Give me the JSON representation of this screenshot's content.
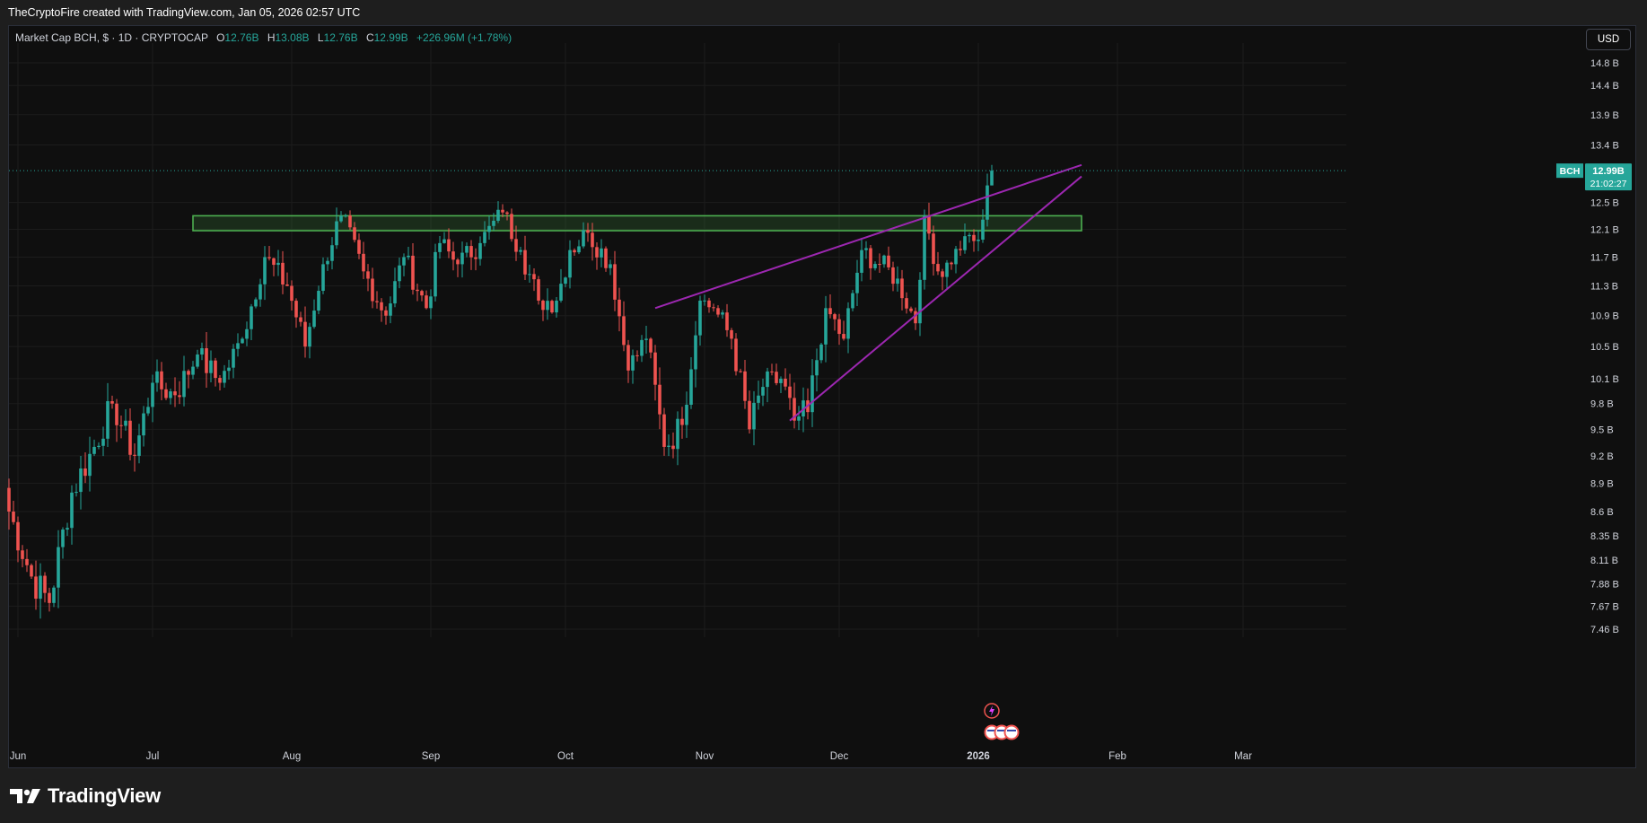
{
  "header": {
    "credit": "TheCryptoFire created with TradingView.com, Jan 05, 2026 02:57 UTC"
  },
  "legend": {
    "symbol": "Market Cap BCH, $ · 1D · CRYPTOCAP",
    "o_label": "O",
    "o_value": "12.76B",
    "h_label": "H",
    "h_value": "13.08B",
    "l_label": "L",
    "l_value": "12.76B",
    "c_label": "C",
    "c_value": "12.99B",
    "change": "+226.96M (+1.78%)"
  },
  "currency_button": "USD",
  "price_tag": {
    "symbol": "BCH",
    "price": "12.99B",
    "countdown": "21:02:27"
  },
  "footer": {
    "logo_text": "TradingView"
  },
  "colors": {
    "up": "#26a69a",
    "down": "#ef5350",
    "zone": "#4caf50",
    "trendline": "#9c27b0",
    "grid": "#1c1c1c"
  },
  "chart_data": {
    "type": "candlestick",
    "y_axis": {
      "scale": "log",
      "unit": "USD billions",
      "ticks": [
        7.46,
        7.67,
        7.88,
        8.11,
        8.35,
        8.6,
        8.9,
        9.2,
        9.5,
        9.8,
        10.1,
        10.5,
        10.9,
        11.3,
        11.7,
        12.1,
        12.5,
        13.4,
        13.9,
        14.4,
        14.8
      ],
      "tick_labels": [
        "7.46 B",
        "7.67 B",
        "7.88 B",
        "8.11 B",
        "8.35 B",
        "8.6 B",
        "8.9 B",
        "9.2 B",
        "9.5 B",
        "9.8 B",
        "10.1 B",
        "10.5 B",
        "10.9 B",
        "11.3 B",
        "11.7 B",
        "12.1 B",
        "12.5 B",
        "13.4 B",
        "13.9 B",
        "14.4 B",
        "14.8 B"
      ]
    },
    "x_axis": {
      "start": "2025-05-30",
      "ticks": [
        {
          "date": "2025-06-01",
          "label": "Jun"
        },
        {
          "date": "2025-07-01",
          "label": "Jul"
        },
        {
          "date": "2025-08-01",
          "label": "Aug"
        },
        {
          "date": "2025-09-01",
          "label": "Sep"
        },
        {
          "date": "2025-10-01",
          "label": "Oct"
        },
        {
          "date": "2025-11-01",
          "label": "Nov"
        },
        {
          "date": "2025-12-01",
          "label": "Dec"
        },
        {
          "date": "2026-01-01",
          "label": "2026"
        },
        {
          "date": "2026-02-01",
          "label": "Feb"
        },
        {
          "date": "2026-03-01",
          "label": "Mar"
        }
      ]
    },
    "anchors": [
      {
        "date": "2025-05-30",
        "close": 8.6
      },
      {
        "date": "2025-06-04",
        "close": 7.95
      },
      {
        "date": "2025-06-08",
        "close": 7.7
      },
      {
        "date": "2025-06-13",
        "close": 8.8
      },
      {
        "date": "2025-06-18",
        "close": 9.3
      },
      {
        "date": "2025-06-22",
        "close": 9.8
      },
      {
        "date": "2025-06-27",
        "close": 9.2
      },
      {
        "date": "2025-07-01",
        "close": 10.05
      },
      {
        "date": "2025-07-06",
        "close": 9.9
      },
      {
        "date": "2025-07-11",
        "close": 10.4
      },
      {
        "date": "2025-07-16",
        "close": 10.05
      },
      {
        "date": "2025-07-21",
        "close": 10.6
      },
      {
        "date": "2025-07-26",
        "close": 11.7
      },
      {
        "date": "2025-07-31",
        "close": 11.3
      },
      {
        "date": "2025-08-04",
        "close": 10.5
      },
      {
        "date": "2025-08-08",
        "close": 11.6
      },
      {
        "date": "2025-08-12",
        "close": 12.3
      },
      {
        "date": "2025-08-17",
        "close": 11.5
      },
      {
        "date": "2025-08-22",
        "close": 10.9
      },
      {
        "date": "2025-08-26",
        "close": 11.7
      },
      {
        "date": "2025-08-31",
        "close": 11.0
      },
      {
        "date": "2025-09-03",
        "close": 11.9
      },
      {
        "date": "2025-09-07",
        "close": 11.6
      },
      {
        "date": "2025-09-12",
        "close": 11.9
      },
      {
        "date": "2025-09-17",
        "close": 12.35
      },
      {
        "date": "2025-09-21",
        "close": 11.8
      },
      {
        "date": "2025-09-25",
        "close": 11.1
      },
      {
        "date": "2025-09-29",
        "close": 11.1
      },
      {
        "date": "2025-10-02",
        "close": 11.8
      },
      {
        "date": "2025-10-06",
        "close": 12.05
      },
      {
        "date": "2025-10-11",
        "close": 11.6
      },
      {
        "date": "2025-10-15",
        "close": 10.2
      },
      {
        "date": "2025-10-19",
        "close": 10.6
      },
      {
        "date": "2025-10-23",
        "close": 9.3
      },
      {
        "date": "2025-10-27",
        "close": 9.55
      },
      {
        "date": "2025-10-31",
        "close": 11.1
      },
      {
        "date": "2025-11-03",
        "close": 11.0
      },
      {
        "date": "2025-11-07",
        "close": 10.6
      },
      {
        "date": "2025-11-11",
        "close": 9.5
      },
      {
        "date": "2025-11-14",
        "close": 10.0
      },
      {
        "date": "2025-11-18",
        "close": 10.1
      },
      {
        "date": "2025-11-21",
        "close": 9.6
      },
      {
        "date": "2025-11-24",
        "close": 9.7
      },
      {
        "date": "2025-11-28",
        "close": 11.0
      },
      {
        "date": "2025-12-02",
        "close": 10.6
      },
      {
        "date": "2025-12-06",
        "close": 11.8
      },
      {
        "date": "2025-12-10",
        "close": 11.6
      },
      {
        "date": "2025-12-14",
        "close": 11.4
      },
      {
        "date": "2025-12-18",
        "close": 10.8
      },
      {
        "date": "2025-12-20",
        "close": 12.3
      },
      {
        "date": "2025-12-23",
        "close": 11.5
      },
      {
        "date": "2025-12-26",
        "close": 11.6
      },
      {
        "date": "2025-12-29",
        "close": 12.0
      },
      {
        "date": "2026-01-01",
        "close": 11.95
      },
      {
        "date": "2026-01-03",
        "close": 12.76
      },
      {
        "date": "2026-01-04",
        "close": 12.99
      }
    ],
    "last": {
      "open": 12.76,
      "high": 13.08,
      "low": 12.76,
      "close": 12.99
    },
    "zone": {
      "from": "2025-07-10",
      "to": "2026-01-24",
      "low": 12.08,
      "high": 12.3
    },
    "trendlines": [
      {
        "from": {
          "date": "2025-10-21",
          "value": 11.0
        },
        "to": {
          "date": "2026-01-24",
          "value": 13.08
        }
      },
      {
        "from": {
          "date": "2025-11-20",
          "value": 9.6
        },
        "to": {
          "date": "2026-01-24",
          "value": 12.9
        }
      }
    ]
  }
}
